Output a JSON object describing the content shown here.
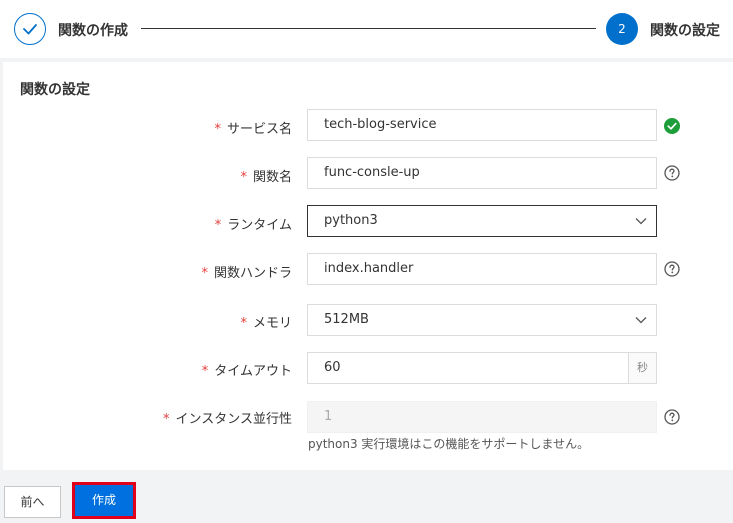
{
  "stepper": {
    "step1_label": "関数の作成",
    "step2_number": "2",
    "step2_label": "関数の設定"
  },
  "panel": {
    "title": "関数の設定",
    "required_mark": "*",
    "fields": {
      "service_name": {
        "label": "サービス名",
        "value": "tech-blog-service"
      },
      "function_name": {
        "label": "関数名",
        "value": "func-consle-up"
      },
      "runtime": {
        "label": "ランタイム",
        "value": "python3"
      },
      "handler": {
        "label": "関数ハンドラ",
        "value": "index.handler"
      },
      "memory": {
        "label": "メモリ",
        "value": "512MB"
      },
      "timeout": {
        "label": "タイムアウト",
        "value": "60",
        "unit": "秒"
      },
      "concurrency": {
        "label": "インスタンス並行性",
        "value": "1",
        "hint": "python3 実行環境はこの機能をサポートしません。"
      }
    }
  },
  "buttons": {
    "prev": "前へ",
    "create": "作成"
  },
  "colors": {
    "accent": "#0070cc",
    "required": "#e23c39",
    "success": "#1e9e3a",
    "highlight": "#e0001b"
  },
  "icons": {
    "step_done": "check-icon",
    "valid": "check-circle-icon",
    "help": "question-circle-icon",
    "dropdown": "chevron-down-icon"
  }
}
